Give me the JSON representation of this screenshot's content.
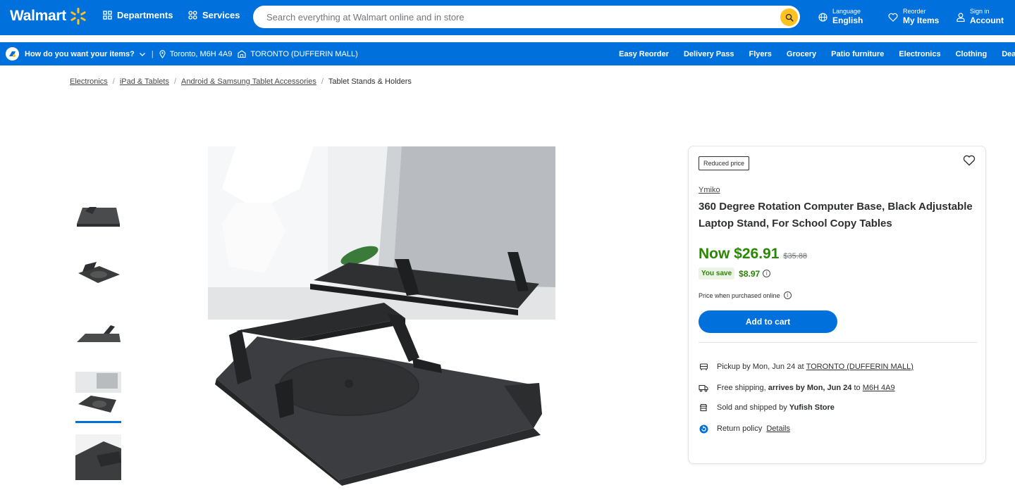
{
  "header": {
    "logo_text": "Walmart",
    "departments_label": "Departments",
    "services_label": "Services",
    "search_placeholder": "Search everything at Walmart online and in store",
    "language": {
      "small": "Language",
      "big": "English"
    },
    "reorder": {
      "small": "Reorder",
      "big": "My Items"
    },
    "account": {
      "small": "Sign in",
      "big": "Account"
    }
  },
  "subbar": {
    "question": "How do you want your items?",
    "postal": "Toronto, M6H 4A9",
    "store": "TORONTO (DUFFERIN MALL)",
    "links": [
      "Easy Reorder",
      "Delivery Pass",
      "Flyers",
      "Grocery",
      "Patio furniture",
      "Electronics",
      "Clothing",
      "Deals of t"
    ]
  },
  "breadcrumb": {
    "items": [
      "Electronics",
      "iPad & Tablets",
      "Android & Samsung Tablet Accessories"
    ],
    "current": "Tablet Stands & Holders"
  },
  "product": {
    "badge": "Reduced price",
    "brand": "Ymiko",
    "title": "360 Degree Rotation Computer Base, Black Adjustable Laptop Stand, For School Copy Tables",
    "price_now": "Now $26.91",
    "price_was": "$35.88",
    "you_save_label": "You save",
    "you_save_amount": "$8.97",
    "price_note": "Price when purchased online",
    "add_to_cart": "Add to cart"
  },
  "fulfillment": {
    "pickup_text": "Pickup by Mon, Jun 24 at",
    "pickup_store": "TORONTO (DUFFERIN MALL)",
    "shipping_prefix": "Free shipping,",
    "shipping_arrives": "arrives by Mon, Jun 24",
    "shipping_to": "to",
    "shipping_postal": "M6H 4A9",
    "sold_prefix": "Sold and shipped by",
    "seller": "Yufish Store",
    "return_label": "Return policy",
    "return_link": "Details"
  },
  "colors": {
    "brand_blue": "#0071dc",
    "spark_yellow": "#ffc220",
    "price_green": "#2a8703"
  },
  "thumbnails": {
    "active_index": 3
  }
}
